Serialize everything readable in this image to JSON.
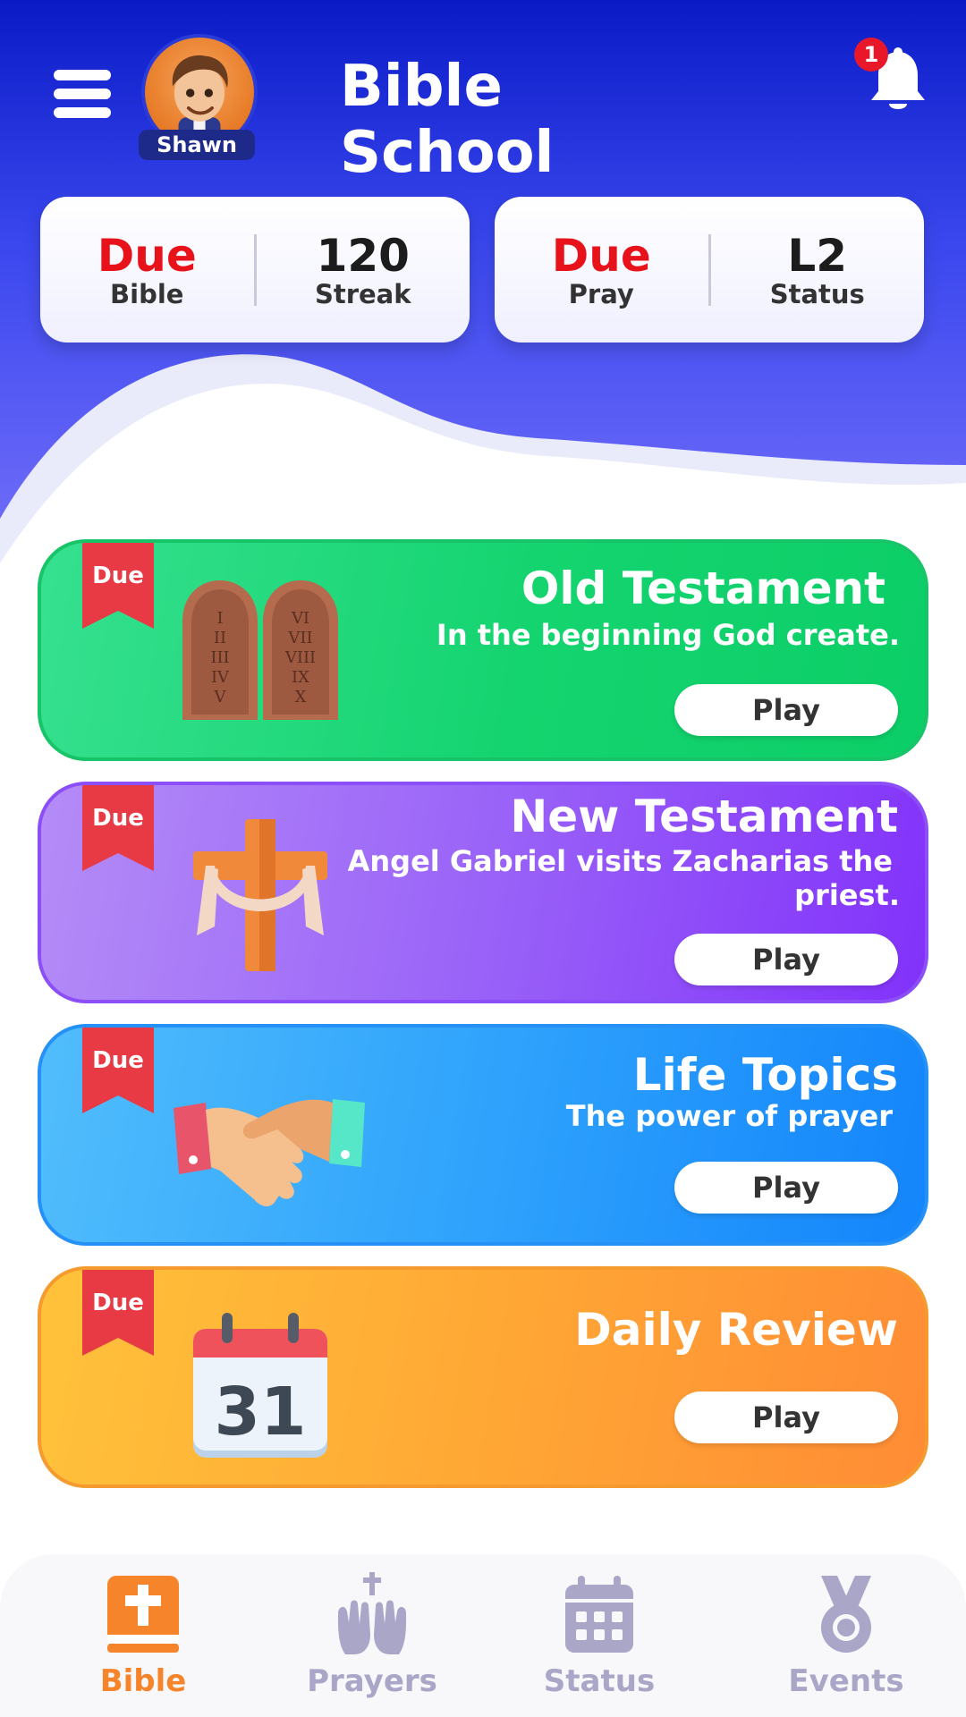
{
  "app": {
    "title": "Bible School"
  },
  "user": {
    "name": "Shawn"
  },
  "notifications": {
    "count": "1"
  },
  "stats": [
    {
      "value": "Due",
      "label": "Bible",
      "value_style": "due"
    },
    {
      "value": "120",
      "label": "Streak",
      "value_style": "number"
    },
    {
      "value": "Due",
      "label": "Pray",
      "value_style": "due"
    },
    {
      "value": "L2",
      "label": "Status",
      "value_style": "number"
    }
  ],
  "sections": [
    {
      "badge": "Due",
      "title": "Old Testament",
      "subtitle": "In the beginning God create.",
      "button": "Play",
      "color": "#14d46f",
      "icon": "stone-tablets-icon"
    },
    {
      "badge": "Due",
      "title": "New Testament",
      "subtitle_line1": "Angel Gabriel visits Zacharias the",
      "subtitle_line2": "priest.",
      "button": "Play",
      "color": "#8c4ef6",
      "icon": "cross-icon"
    },
    {
      "badge": "Due",
      "title": "Life Topics",
      "subtitle": "The power of prayer",
      "button": "Play",
      "color": "#2590f6",
      "icon": "handshake-icon"
    },
    {
      "badge": "Due",
      "title": "Daily Review",
      "button": "Play",
      "calendar_day": "31",
      "color": "#ff9a35",
      "icon": "calendar-icon"
    }
  ],
  "nav": [
    {
      "label": "Bible",
      "icon": "bible-icon",
      "active": true
    },
    {
      "label": "Prayers",
      "icon": "praying-hands-icon",
      "active": false
    },
    {
      "label": "Status",
      "icon": "calendar-icon",
      "active": false
    },
    {
      "label": "Events",
      "icon": "medal-icon",
      "active": false
    }
  ],
  "colors": {
    "header_top": "#0a1bc6",
    "due_red": "#e8121a",
    "nav_active": "#f5842a",
    "nav_inactive": "#a9a6c8"
  }
}
